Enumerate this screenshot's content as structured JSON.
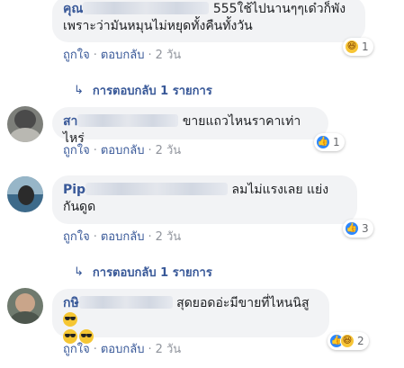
{
  "comments": [
    {
      "name": "คุณ",
      "text_line1": "555ใช้ไปนานๆๆเด๋วก็พัง",
      "text_line2": "เพราะว่ามันหมุนไม่หยุดทั้งคืนทั้งวัน",
      "reactions": [
        "haha"
      ],
      "reaction_count": "1",
      "actions": {
        "like": "ถูกใจ",
        "reply": "ตอบกลับ",
        "time": "2 วัน"
      }
    },
    {
      "name": "สา",
      "text_line1": "ขายแถวไหนราคาเท่าไหร่",
      "reactions": [
        "like"
      ],
      "reaction_count": "1",
      "actions": {
        "like": "ถูกใจ",
        "reply": "ตอบกลับ",
        "time": "2 วัน"
      }
    },
    {
      "name": "Pip",
      "text_line1": "ลมไม่แรงเลย แย่ง",
      "text_line2": "กันดูด",
      "reactions": [
        "like"
      ],
      "reaction_count": "3",
      "actions": {
        "like": "ถูกใจ",
        "reply": "ตอบกลับ",
        "time": "2 วัน"
      }
    },
    {
      "name": "กษิ",
      "text_line1": "สุดยอดอ่ะมีขายที่ไหนนิสู",
      "reactions": [
        "like",
        "haha"
      ],
      "reaction_count": "2",
      "actions": {
        "like": "ถูกใจ",
        "reply": "ตอบกลับ",
        "time": "2 วัน"
      }
    }
  ],
  "replies_link": "การตอบกลับ 1 รายการ",
  "dot": "·",
  "colors": {
    "link": "#385898",
    "meta": "#90949c",
    "bubble": "#f2f3f5",
    "like": "#2d88ff",
    "haha": "#f7c536"
  }
}
